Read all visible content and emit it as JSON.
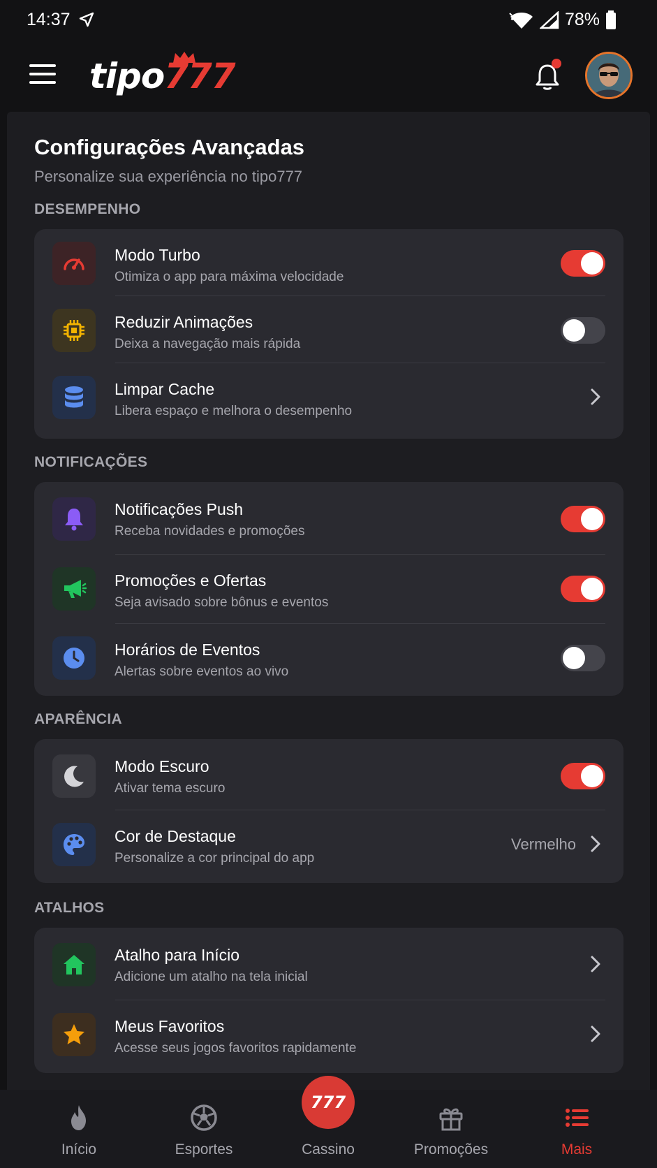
{
  "status_bar": {
    "time": "14:37",
    "battery": "78%"
  },
  "header": {
    "logo_main": "tipo",
    "logo_accent": "777"
  },
  "page": {
    "title": "Configurações Avançadas",
    "subtitle": "Personalize sua experiência no tipo777"
  },
  "sections": {
    "performance": {
      "title": "DESEMPENHO",
      "items": [
        {
          "title": "Modo Turbo",
          "desc": "Otimiza o app para máxima velocidade",
          "toggle": true,
          "icon": "speedometer-icon",
          "color": "#e63b33"
        },
        {
          "title": "Reduzir Animações",
          "desc": "Deixa a navegação mais rápida",
          "toggle": false,
          "icon": "chip-icon",
          "color": "#f2b300"
        },
        {
          "title": "Limpar Cache",
          "desc": "Libera espaço e melhora o desempenho",
          "icon": "database-icon",
          "color": "#5b8def"
        }
      ]
    },
    "notifications": {
      "title": "NOTIFICAÇÕES",
      "items": [
        {
          "title": "Notificações Push",
          "desc": "Receba novidades e promoções",
          "toggle": true,
          "icon": "bell-icon",
          "color": "#8b5cf6"
        },
        {
          "title": "Promoções e Ofertas",
          "desc": "Seja avisado sobre bônus e eventos",
          "toggle": true,
          "icon": "megaphone-icon",
          "color": "#22c55e"
        },
        {
          "title": "Horários de Eventos",
          "desc": "Alertas sobre eventos ao vivo",
          "toggle": false,
          "icon": "clock-icon",
          "color": "#5b8def"
        }
      ]
    },
    "appearance": {
      "title": "APARÊNCIA",
      "items": [
        {
          "title": "Modo Escuro",
          "desc": "Ativar tema escuro",
          "toggle": true,
          "icon": "moon-icon",
          "color": "#d4d4d8"
        },
        {
          "title": "Cor de Destaque",
          "desc": "Personalize a cor principal do app",
          "value": "Vermelho",
          "icon": "palette-icon",
          "color": "#5b8def"
        }
      ]
    },
    "shortcuts": {
      "title": "ATALHOS",
      "items": [
        {
          "title": "Atalho para Início",
          "desc": "Adicione um atalho na tela inicial",
          "icon": "home-icon",
          "color": "#22c55e"
        },
        {
          "title": "Meus Favoritos",
          "desc": "Acesse seus jogos favoritos rapidamente",
          "icon": "star-icon",
          "color": "#f59e0b"
        }
      ]
    }
  },
  "bottom_nav": {
    "items": [
      {
        "label": "Início",
        "icon": "flame-icon"
      },
      {
        "label": "Esportes",
        "icon": "soccer-ball-icon"
      },
      {
        "label": "Cassino",
        "icon": "777-icon",
        "badge": "777"
      },
      {
        "label": "Promoções",
        "icon": "gift-icon"
      },
      {
        "label": "Mais",
        "icon": "list-icon",
        "active": true
      }
    ]
  },
  "colors": {
    "accent": "#e63b33",
    "background": "#121214",
    "card": "#2a2a30"
  }
}
